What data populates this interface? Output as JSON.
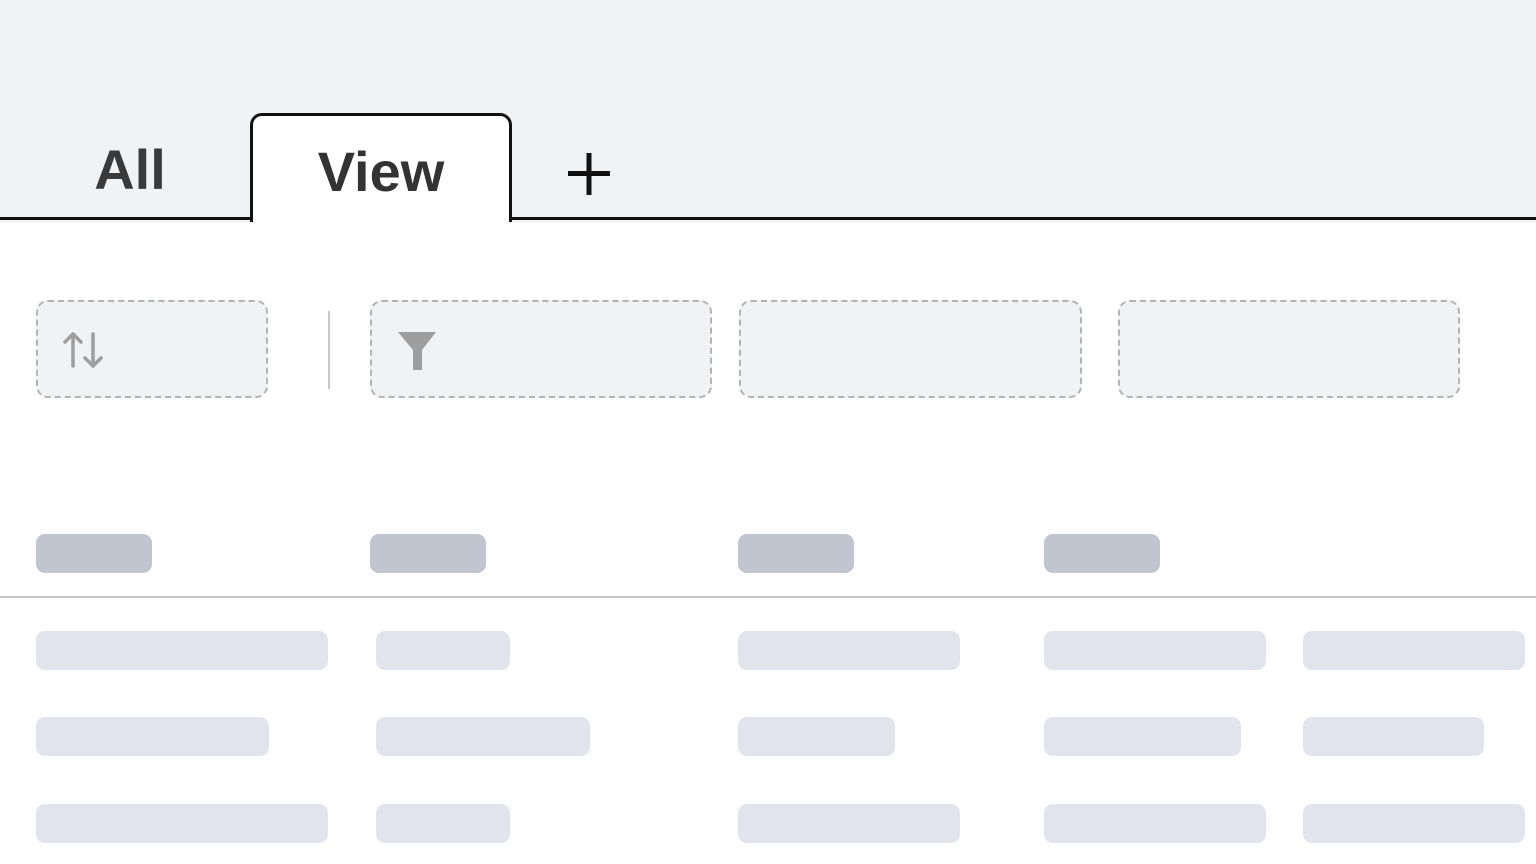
{
  "tabs": [
    {
      "label": "All",
      "active": false
    },
    {
      "label": "View",
      "active": true
    }
  ],
  "add_tab": {
    "icon": "plus-icon"
  },
  "toolbar": {
    "sort_slot": {
      "icon": "sort-arrows-icon"
    },
    "filter_slot": {
      "icon": "funnel-filter-icon"
    },
    "empty_slots": 2
  },
  "table": {
    "state": "loading",
    "header_placeholders": 4,
    "row_placeholders": 3
  },
  "colors": {
    "tabbar_background": "#f1f2f4",
    "active_tab_border": "#111111",
    "skeleton_header": "#c0c5d0",
    "skeleton_cell": "#e1e4eb",
    "slot_border": "#b3b3b3"
  }
}
